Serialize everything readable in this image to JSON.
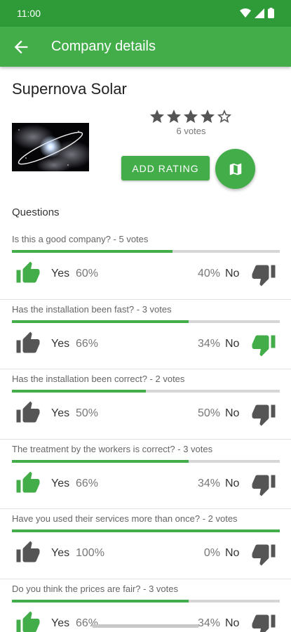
{
  "status_bar": {
    "time": "11:00"
  },
  "app_bar": {
    "title": "Company details"
  },
  "company": {
    "name": "Supernova Solar",
    "rating": 4,
    "max_rating": 5,
    "votes_text": "6 votes",
    "add_rating_label": "ADD RATING"
  },
  "questions_heading": "Questions",
  "labels": {
    "yes": "Yes",
    "no": "No"
  },
  "colors": {
    "primary": "#43ad4a",
    "status_bar": "#2e9a38",
    "icon_inactive": "#555555",
    "track": "#d6d6d6"
  },
  "questions": [
    {
      "text": "Is this a good company? - 5 votes",
      "yes_pct": "60%",
      "no_pct": "40%",
      "yes_fraction": 0.6,
      "selected": "yes"
    },
    {
      "text": "Has the installation been fast? - 3 votes",
      "yes_pct": "66%",
      "no_pct": "34%",
      "yes_fraction": 0.66,
      "selected": "no"
    },
    {
      "text": "Has the installation been correct? - 2 votes",
      "yes_pct": "50%",
      "no_pct": "50%",
      "yes_fraction": 0.5,
      "selected": "none"
    },
    {
      "text": "The treatment by the workers is correct? - 3 votes",
      "yes_pct": "66%",
      "no_pct": "34%",
      "yes_fraction": 0.66,
      "selected": "yes"
    },
    {
      "text": "Have you used their services more than once? - 2 votes",
      "yes_pct": "100%",
      "no_pct": "0%",
      "yes_fraction": 1.0,
      "selected": "none"
    },
    {
      "text": "Do you think the prices are fair? - 3 votes",
      "yes_pct": "66%",
      "no_pct": "34%",
      "yes_fraction": 0.66,
      "selected": "yes"
    }
  ]
}
